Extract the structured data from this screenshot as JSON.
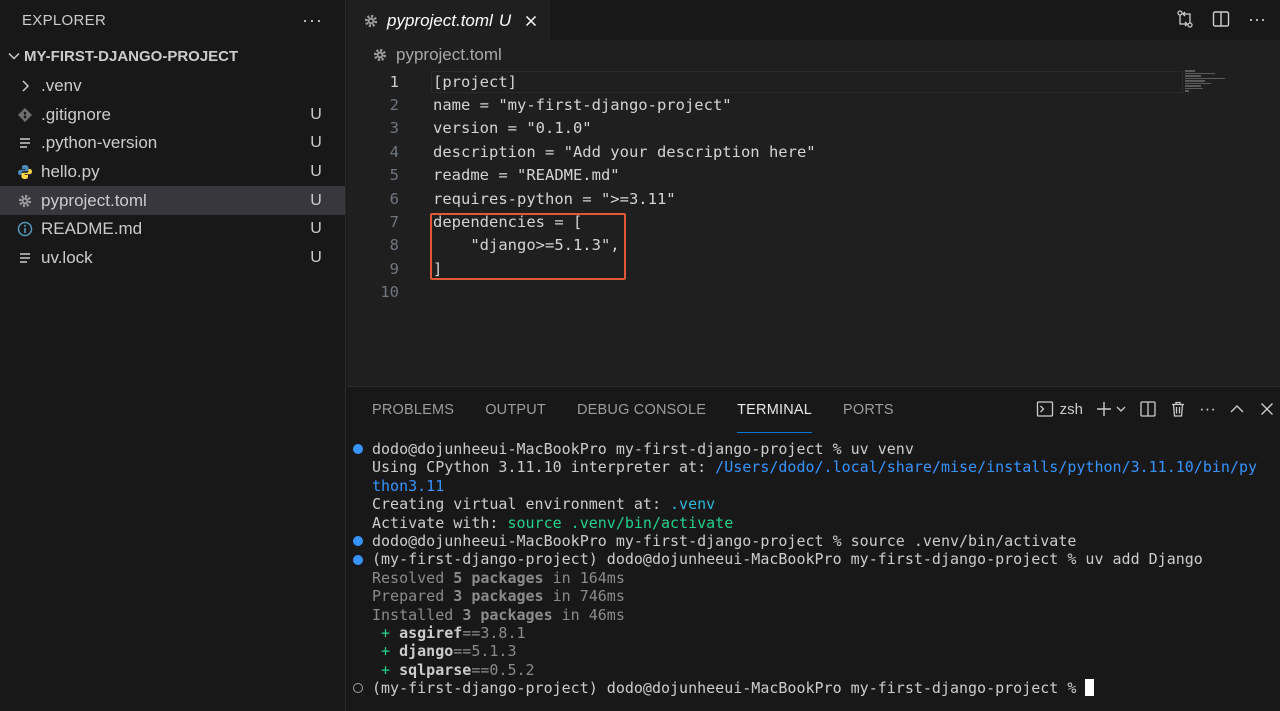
{
  "sidebar": {
    "title": "EXPLORER",
    "more": "···",
    "project": "MY-FIRST-DJANGO-PROJECT",
    "files": [
      {
        "name": ".venv",
        "status": "",
        "icon": "chevron-right-icon"
      },
      {
        "name": ".gitignore",
        "status": "U",
        "icon": "git-icon"
      },
      {
        "name": ".python-version",
        "status": "U",
        "icon": "lines-icon"
      },
      {
        "name": "hello.py",
        "status": "U",
        "icon": "python-icon"
      },
      {
        "name": "pyproject.toml",
        "status": "U",
        "icon": "gear-icon",
        "selected": true
      },
      {
        "name": "README.md",
        "status": "U",
        "icon": "info-icon"
      },
      {
        "name": "uv.lock",
        "status": "U",
        "icon": "lines-icon"
      }
    ]
  },
  "editor": {
    "tab": {
      "name": "pyproject.toml",
      "status": "U"
    },
    "breadcrumb": "pyproject.toml",
    "lines": [
      {
        "n": "1",
        "text": "[project]"
      },
      {
        "n": "2",
        "text": "name = \"my-first-django-project\""
      },
      {
        "n": "3",
        "text": "version = \"0.1.0\""
      },
      {
        "n": "4",
        "text": "description = \"Add your description here\""
      },
      {
        "n": "5",
        "text": "readme = \"README.md\""
      },
      {
        "n": "6",
        "text": "requires-python = \">=3.11\""
      },
      {
        "n": "7",
        "text": "dependencies = ["
      },
      {
        "n": "8",
        "text": "    \"django>=5.1.3\","
      },
      {
        "n": "9",
        "text": "]"
      },
      {
        "n": "10",
        "text": ""
      }
    ]
  },
  "panel": {
    "tabs": [
      "PROBLEMS",
      "OUTPUT",
      "DEBUG CONSOLE",
      "TERMINAL",
      "PORTS"
    ],
    "active_tab": "TERMINAL",
    "shell": "zsh",
    "terminal": {
      "l1": "dodo@dojunheeui-MacBookPro my-first-django-project % uv venv",
      "l2a": "Using CPython 3.11.10 interpreter at: ",
      "l2b": "/Users/dodo/.local/share/mise/installs/python/3.11.10/bin/py",
      "l3": "thon3.11",
      "l4a": "Creating virtual environment at: ",
      "l4b": ".venv",
      "l5a": "Activate with: ",
      "l5b": "source .venv/bin/activate",
      "l6": "dodo@dojunheeui-MacBookPro my-first-django-project % source .venv/bin/activate",
      "l7": "(my-first-django-project) dodo@dojunheeui-MacBookPro my-first-django-project % uv add Django",
      "resolved": {
        "a": "Resolved ",
        "b": "5 packages",
        "c": " in 164ms"
      },
      "prepared": {
        "a": "Prepared ",
        "b": "3 packages",
        "c": " in 746ms"
      },
      "installed": {
        "a": "Installed ",
        "b": "3 packages",
        "c": " in 46ms"
      },
      "pkgs": [
        {
          "plus": " + ",
          "name": "asgiref",
          "ver": "==3.8.1"
        },
        {
          "plus": " + ",
          "name": "django",
          "ver": "==5.1.3"
        },
        {
          "plus": " + ",
          "name": "sqlparse",
          "ver": "==0.5.2"
        }
      ],
      "prompt": "(my-first-django-project) dodo@dojunheeui-MacBookPro my-first-django-project % "
    }
  },
  "colors": {
    "accent": "#0078d4",
    "highlight": "#e05a3a",
    "link": "#3794ff",
    "green": "#23d18b"
  }
}
